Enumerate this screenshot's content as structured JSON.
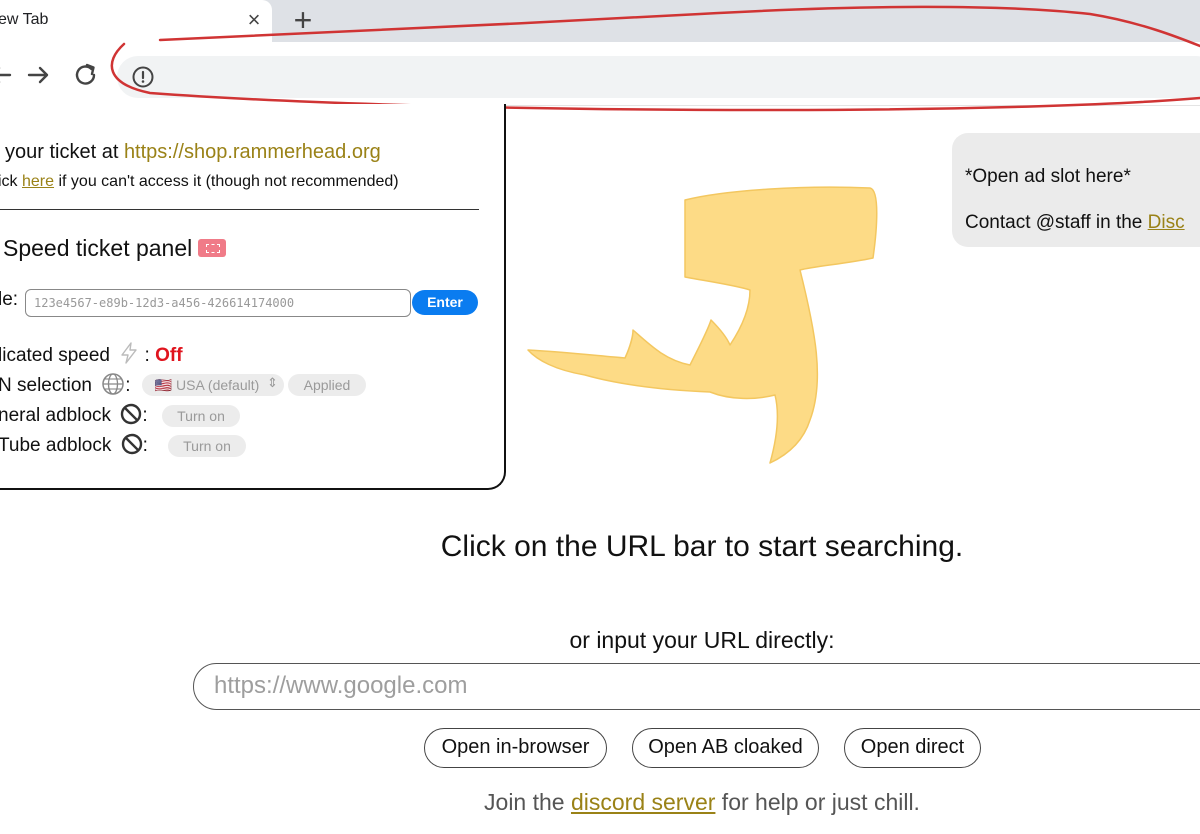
{
  "browser": {
    "tab_title": "ew Tab",
    "tab_close": "×",
    "new_tab": "+",
    "annotation_color": "#d03434"
  },
  "panel": {
    "ticket_line_prefix": "your ticket at ",
    "ticket_link": "https://shop.rammerhead.org",
    "access_prefix": "ick ",
    "access_link": "here",
    "access_suffix": " if you can't access it (though not recommended)",
    "title": "Speed ticket panel",
    "code_label": "le:",
    "code_placeholder": "123e4567-e89b-12d3-a456-426614174000",
    "enter_label": "Enter",
    "dedicated_label": "licated speed",
    "dedicated_value": "Off",
    "vpn_label": "N selection",
    "vpn_select": "🇺🇸 USA (default)",
    "vpn_applied": "Applied",
    "general_label": "neral adblock",
    "general_btn": "Turn on",
    "youtube_label": "Tube adblock",
    "youtube_btn": "Turn on"
  },
  "ad": {
    "line1": "*Open ad slot here*",
    "line2_prefix": "Contact @staff in the ",
    "line2_link": "Disc"
  },
  "main": {
    "headline": "Click on the URL bar to start searching.",
    "sub": "or input your URL directly:",
    "url_placeholder": "https://www.google.com",
    "btn_inbrowser": "Open in-browser",
    "btn_ab": "Open AB cloaked",
    "btn_direct": "Open direct",
    "footer_prefix": "Join the ",
    "footer_link": "discord server",
    "footer_suffix": " for help or just chill."
  },
  "colors": {
    "link": "#9a8217",
    "enter_button": "#0a7cf0",
    "off_status": "#e0141e",
    "shark": "#fddb86"
  }
}
